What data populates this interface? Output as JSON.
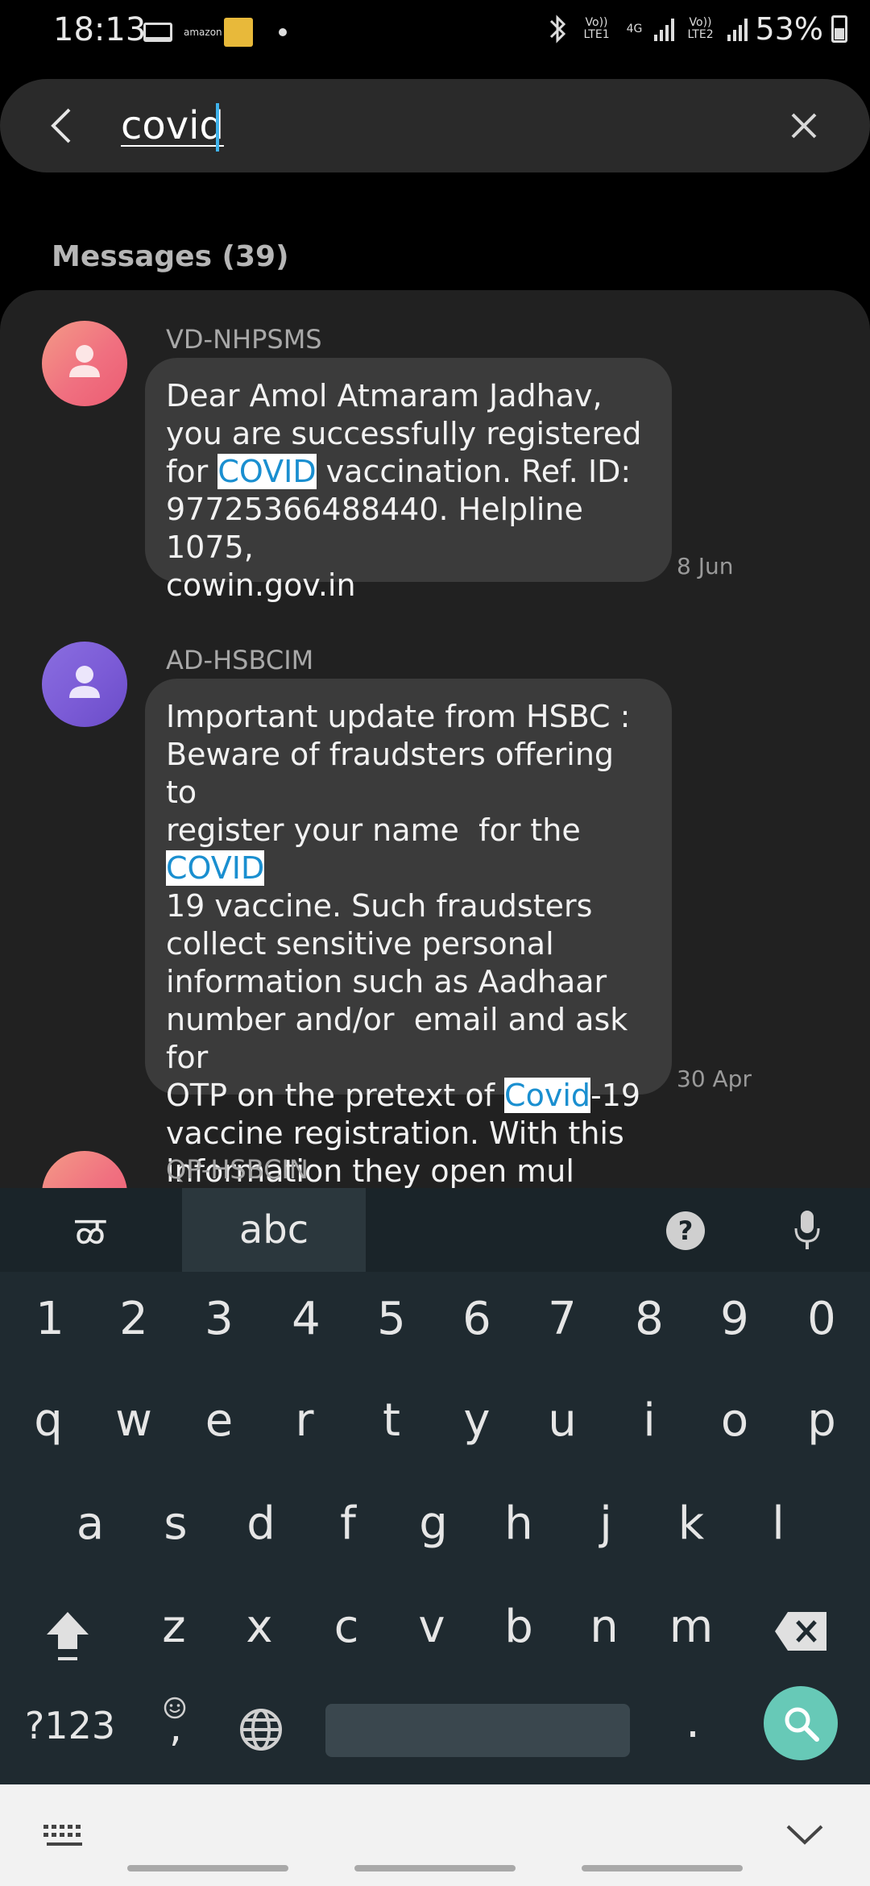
{
  "status_bar": {
    "time": "18:13",
    "amazon_text": "amazon",
    "sim1_label": "Vo)) LTE1",
    "network_label": "4G",
    "sim2_label": "Vo)) LTE2",
    "battery": "53%"
  },
  "search": {
    "query": "covid"
  },
  "results": {
    "section_label": "Messages (39)",
    "messages": [
      {
        "sender": "VD-NHPSMS",
        "text_before": "Dear Amol Atmaram Jadhav,\nyou are successfully registered\nfor ",
        "highlight1": "COVID",
        "text_after": " vaccination. Ref. ID:\n97725366488440. Helpline 1075,\ncowin.gov.in",
        "date": "8 Jun",
        "avatar_color": "#f07080"
      },
      {
        "sender": "AD-HSBCIM",
        "text_before": "Important update from HSBC :\nBeware of fraudsters offering to\nregister your name  for the ",
        "highlight1": "COVID",
        "text_middle": "\n19 vaccine. Such fraudsters\ncollect sensitive personal\ninformation such as Aadhaar\nnumber and/or  email and ask for\nOTP on the pretext of ",
        "highlight2": "Covid",
        "text_after": "-19\nvaccine registration. With this\ninformation they open mul",
        "date": "30 Apr",
        "avatar_color": "#7b5bd6"
      },
      {
        "sender": "QP-HSBCIN",
        "avatar_color": "#f07080"
      }
    ]
  },
  "keyboard": {
    "lang_tab": "ळ",
    "abc_tab": "abc",
    "numbers": [
      "1",
      "2",
      "3",
      "4",
      "5",
      "6",
      "7",
      "8",
      "9",
      "0"
    ],
    "row1": [
      "q",
      "w",
      "e",
      "r",
      "t",
      "y",
      "u",
      "i",
      "o",
      "p"
    ],
    "row2": [
      "a",
      "s",
      "d",
      "f",
      "g",
      "h",
      "j",
      "k",
      "l"
    ],
    "row3": [
      "z",
      "x",
      "c",
      "v",
      "b",
      "n",
      "m"
    ],
    "symbols_key": "?123",
    "comma_key": ",",
    "period_key": "."
  }
}
